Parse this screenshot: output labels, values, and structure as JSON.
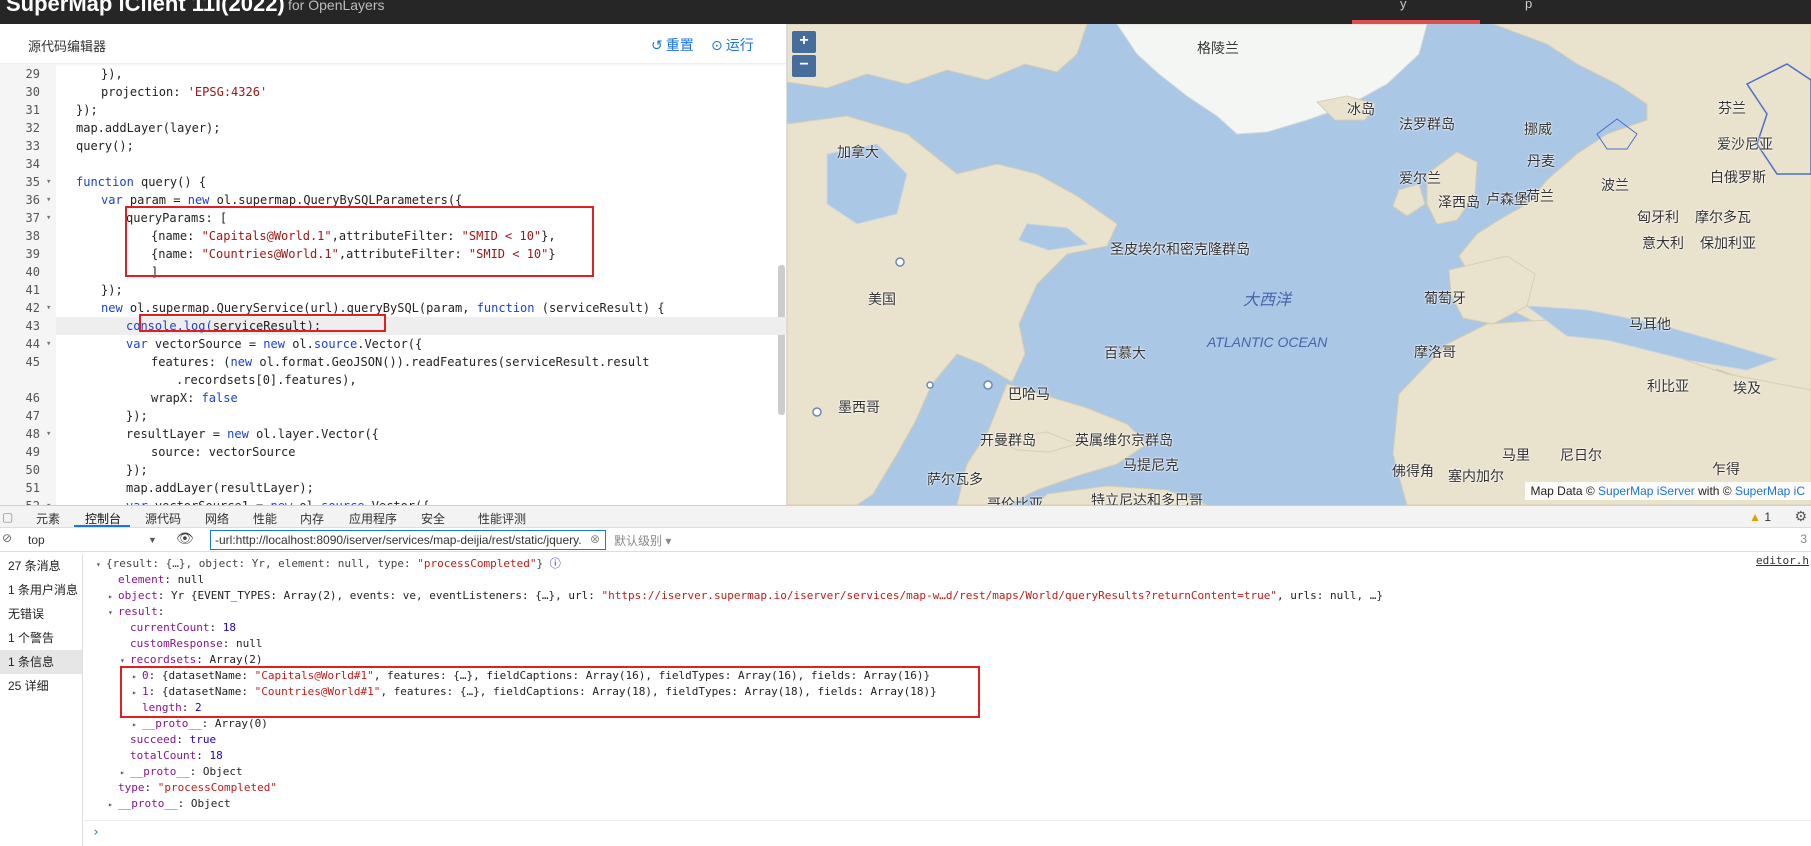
{
  "app": {
    "title": "SuperMap iClient 11i(2022)",
    "subtitle": "for OpenLayers",
    "tab_fragment_a": "y",
    "tab_fragment_b": "p"
  },
  "editor": {
    "title": "源代码编辑器",
    "reset_label": "重置",
    "run_label": "运行",
    "lines": [
      {
        "n": "29",
        "fold": "",
        "indent": 2,
        "segs": [
          {
            "t": "}),",
            "c": "plain"
          }
        ]
      },
      {
        "n": "30",
        "fold": "",
        "indent": 2,
        "segs": [
          {
            "t": "projection: ",
            "c": "plain"
          },
          {
            "t": "'EPSG:4326'",
            "c": "str"
          }
        ]
      },
      {
        "n": "31",
        "fold": "",
        "indent": 1,
        "segs": [
          {
            "t": "});",
            "c": "plain"
          }
        ]
      },
      {
        "n": "32",
        "fold": "",
        "indent": 1,
        "segs": [
          {
            "t": "map.addLayer(layer);",
            "c": "plain"
          }
        ]
      },
      {
        "n": "33",
        "fold": "",
        "indent": 1,
        "segs": [
          {
            "t": "query();",
            "c": "plain"
          }
        ]
      },
      {
        "n": "34",
        "fold": "",
        "indent": 0,
        "segs": []
      },
      {
        "n": "35",
        "fold": "▾",
        "indent": 1,
        "segs": [
          {
            "t": "function",
            "c": "kw"
          },
          {
            "t": " query() {",
            "c": "plain"
          }
        ]
      },
      {
        "n": "36",
        "fold": "▾",
        "indent": 2,
        "segs": [
          {
            "t": "var",
            "c": "kw"
          },
          {
            "t": " param = ",
            "c": "plain"
          },
          {
            "t": "new",
            "c": "kw"
          },
          {
            "t": " ol.supermap.QueryBySQLParameters({",
            "c": "plain"
          }
        ]
      },
      {
        "n": "37",
        "fold": "▾",
        "indent": 3,
        "segs": [
          {
            "t": "queryParams: [",
            "c": "plain"
          }
        ]
      },
      {
        "n": "38",
        "fold": "",
        "indent": 4,
        "segs": [
          {
            "t": "{name: ",
            "c": "plain"
          },
          {
            "t": "\"Capitals@World.1\"",
            "c": "str"
          },
          {
            "t": ",attributeFilter: ",
            "c": "plain"
          },
          {
            "t": "\"SMID < 10\"",
            "c": "str"
          },
          {
            "t": "},",
            "c": "plain"
          }
        ]
      },
      {
        "n": "39",
        "fold": "",
        "indent": 4,
        "segs": [
          {
            "t": "{name: ",
            "c": "plain"
          },
          {
            "t": "\"Countries@World.1\"",
            "c": "str"
          },
          {
            "t": ",attributeFilter: ",
            "c": "plain"
          },
          {
            "t": "\"SMID < 10\"",
            "c": "str"
          },
          {
            "t": "}",
            "c": "plain"
          }
        ]
      },
      {
        "n": "40",
        "fold": "",
        "indent": 4,
        "segs": [
          {
            "t": "]",
            "c": "plain"
          }
        ]
      },
      {
        "n": "41",
        "fold": "",
        "indent": 2,
        "segs": [
          {
            "t": "});",
            "c": "plain"
          }
        ]
      },
      {
        "n": "42",
        "fold": "▾",
        "indent": 2,
        "segs": [
          {
            "t": "new",
            "c": "kw"
          },
          {
            "t": " ol.supermap.QueryService(url).queryBySQL(param, ",
            "c": "plain"
          },
          {
            "t": "function",
            "c": "kw"
          },
          {
            "t": " (serviceResult) {",
            "c": "plain"
          }
        ]
      },
      {
        "n": "43",
        "fold": "",
        "indent": 3,
        "hl": true,
        "segs": [
          {
            "t": "console.log(",
            "c": "cl"
          },
          {
            "t": "serviceResult);",
            "c": "plain"
          }
        ]
      },
      {
        "n": "44",
        "fold": "▾",
        "indent": 3,
        "segs": [
          {
            "t": "var",
            "c": "kw"
          },
          {
            "t": " vectorSource = ",
            "c": "plain"
          },
          {
            "t": "new",
            "c": "kw"
          },
          {
            "t": " ol.",
            "c": "plain"
          },
          {
            "t": "source",
            "c": "kw"
          },
          {
            "t": ".Vector({",
            "c": "plain"
          }
        ]
      },
      {
        "n": "45",
        "fold": "",
        "indent": 4,
        "segs": [
          {
            "t": "features: (",
            "c": "plain"
          },
          {
            "t": "new",
            "c": "kw"
          },
          {
            "t": " ol.format.GeoJSON()).readFeatures(serviceResult.result",
            "c": "plain"
          }
        ]
      },
      {
        "n": "",
        "fold": "",
        "indent": 5,
        "segs": [
          {
            "t": ".recordsets[0].features),",
            "c": "plain"
          }
        ]
      },
      {
        "n": "46",
        "fold": "",
        "indent": 4,
        "segs": [
          {
            "t": "wrapX: ",
            "c": "plain"
          },
          {
            "t": "false",
            "c": "kw"
          }
        ]
      },
      {
        "n": "47",
        "fold": "",
        "indent": 3,
        "segs": [
          {
            "t": "});",
            "c": "plain"
          }
        ]
      },
      {
        "n": "48",
        "fold": "▾",
        "indent": 3,
        "segs": [
          {
            "t": "resultLayer = ",
            "c": "plain"
          },
          {
            "t": "new",
            "c": "kw"
          },
          {
            "t": " ol.layer.Vector({",
            "c": "plain"
          }
        ]
      },
      {
        "n": "49",
        "fold": "",
        "indent": 4,
        "segs": [
          {
            "t": "source: vectorSource",
            "c": "plain"
          }
        ]
      },
      {
        "n": "50",
        "fold": "",
        "indent": 3,
        "segs": [
          {
            "t": "});",
            "c": "plain"
          }
        ]
      },
      {
        "n": "51",
        "fold": "",
        "indent": 3,
        "segs": [
          {
            "t": "map.addLayer(resultLayer);",
            "c": "plain"
          }
        ]
      },
      {
        "n": "52",
        "fold": "▾",
        "indent": 3,
        "segs": [
          {
            "t": "var",
            "c": "kw"
          },
          {
            "t": " vectorSource1 = ",
            "c": "plain"
          },
          {
            "t": "new",
            "c": "kw"
          },
          {
            "t": " ol.",
            "c": "plain"
          },
          {
            "t": "source",
            "c": "kw"
          },
          {
            "t": ".Vector({",
            "c": "plain"
          }
        ]
      }
    ]
  },
  "map": {
    "zoom_in": "+",
    "zoom_out": "−",
    "labels": [
      {
        "name": "greenland",
        "text": "格陵兰"
      },
      {
        "name": "iceland",
        "text": "冰岛"
      },
      {
        "name": "canada",
        "text": "加拿大"
      },
      {
        "name": "faroe",
        "text": "法罗群岛"
      },
      {
        "name": "norway",
        "text": "挪威"
      },
      {
        "name": "denmark",
        "text": "丹麦"
      },
      {
        "name": "finland",
        "text": "芬兰"
      },
      {
        "name": "estonia",
        "text": "爱沙尼亚"
      },
      {
        "name": "ireland",
        "text": "爱尔兰"
      },
      {
        "name": "netherlands",
        "text": "荷兰"
      },
      {
        "name": "belarus",
        "text": "白俄罗斯"
      },
      {
        "name": "poland",
        "text": "波兰"
      },
      {
        "name": "uk-area",
        "text": "泽西岛"
      },
      {
        "name": "luxembourg",
        "text": "卢森堡"
      },
      {
        "name": "czech",
        "text": "匈牙利"
      },
      {
        "name": "moldova",
        "text": "摩尔多瓦"
      },
      {
        "name": "spm",
        "text": "圣皮埃尔和密克隆群岛"
      },
      {
        "name": "italy",
        "text": "意大利"
      },
      {
        "name": "bulgaria",
        "text": "保加利亚"
      },
      {
        "name": "usa",
        "text": "美国"
      },
      {
        "name": "portugal",
        "text": "葡萄牙"
      },
      {
        "name": "malta",
        "text": "马耳他"
      },
      {
        "name": "bermuda",
        "text": "百慕大"
      },
      {
        "name": "morocco",
        "text": "摩洛哥"
      },
      {
        "name": "libya",
        "text": "利比亚"
      },
      {
        "name": "egypt",
        "text": "埃及"
      },
      {
        "name": "bahamas",
        "text": "巴哈马"
      },
      {
        "name": "mexico",
        "text": "墨西哥"
      },
      {
        "name": "cayman",
        "text": "开曼群岛"
      },
      {
        "name": "bvi",
        "text": "英属维尔京群岛"
      },
      {
        "name": "mali",
        "text": "马里"
      },
      {
        "name": "niger",
        "text": "尼日尔"
      },
      {
        "name": "martinique",
        "text": "马提尼克"
      },
      {
        "name": "el-salvador",
        "text": "萨尔瓦多"
      },
      {
        "name": "cape-verde",
        "text": "佛得角"
      },
      {
        "name": "guinea",
        "text": "塞内加尔"
      },
      {
        "name": "chad",
        "text": "乍得"
      },
      {
        "name": "trinidad",
        "text": "特立尼达和多巴哥"
      },
      {
        "name": "colombia",
        "text": "哥伦比亚"
      }
    ],
    "ocean_cn": "大西洋",
    "ocean_en": "ATLANTIC OCEAN",
    "attribution_prefix": "Map Data ©",
    "attribution_link1": "SuperMap iServer",
    "attribution_mid": "with ©",
    "attribution_link2": "SuperMap iC"
  },
  "devtools": {
    "tabs": [
      "元素",
      "控制台",
      "源代码",
      "网络",
      "性能",
      "内存",
      "应用程序",
      "安全",
      "性能评测"
    ],
    "warning_count": "1",
    "context": "top",
    "filter_value": "-url:http://localhost:8090/iserver/services/map-deijia/rest/static/jquery.",
    "levels": "默认级别",
    "hidden_count": "3",
    "sidebar": [
      {
        "label": "27 条消息",
        "selected": false
      },
      {
        "label": "1 条用户消息",
        "selected": false
      },
      {
        "label": "无错误",
        "selected": false
      },
      {
        "label": "1 个警告",
        "selected": false
      },
      {
        "label": "1 条信息",
        "selected": true
      },
      {
        "label": "25 详细",
        "selected": false
      }
    ],
    "source_link": "editor.h",
    "console_lines": [
      {
        "indent": 1,
        "tri": "▾",
        "segs": [
          {
            "t": "{result: {…}, object: Yr, element: null, type: ",
            "c": "g"
          },
          {
            "t": "\"processCompleted\"",
            "c": "s"
          },
          {
            "t": "}",
            "c": "g"
          },
          {
            "t": " ⓘ",
            "c": "n"
          }
        ]
      },
      {
        "indent": 2,
        "tri": "",
        "segs": [
          {
            "t": "element",
            "c": "k"
          },
          {
            "t": ": null",
            "c": "b"
          }
        ]
      },
      {
        "indent": 2,
        "tri": "▸",
        "segs": [
          {
            "t": "object",
            "c": "k"
          },
          {
            "t": ": Yr {EVENT_TYPES: Array(2), events: ve, eventListeners: {…}, url: ",
            "c": "b"
          },
          {
            "t": "\"https://iserver.supermap.io/iserver/services/map-w…d/rest/maps/World/queryResults?returnContent=true\"",
            "c": "s"
          },
          {
            "t": ", urls: null, …}",
            "c": "b"
          }
        ]
      },
      {
        "indent": 2,
        "tri": "▾",
        "segs": [
          {
            "t": "result",
            "c": "k"
          },
          {
            "t": ":",
            "c": "b"
          }
        ]
      },
      {
        "indent": 3,
        "tri": "",
        "segs": [
          {
            "t": "currentCount",
            "c": "k"
          },
          {
            "t": ": ",
            "c": "b"
          },
          {
            "t": "18",
            "c": "n"
          }
        ]
      },
      {
        "indent": 3,
        "tri": "",
        "segs": [
          {
            "t": "customResponse",
            "c": "k"
          },
          {
            "t": ": null",
            "c": "b"
          }
        ]
      },
      {
        "indent": 3,
        "tri": "▾",
        "segs": [
          {
            "t": "recordsets",
            "c": "k"
          },
          {
            "t": ": Array(2)",
            "c": "b"
          }
        ]
      },
      {
        "indent": 4,
        "tri": "▸",
        "segs": [
          {
            "t": "0",
            "c": "k"
          },
          {
            "t": ": {datasetName: ",
            "c": "b"
          },
          {
            "t": "\"Capitals@World#1\"",
            "c": "s"
          },
          {
            "t": ", features: {…}, fieldCaptions: Array(16), fieldTypes: Array(16), fields: Array(16)}",
            "c": "b"
          }
        ]
      },
      {
        "indent": 4,
        "tri": "▸",
        "segs": [
          {
            "t": "1",
            "c": "k"
          },
          {
            "t": ": {datasetName: ",
            "c": "b"
          },
          {
            "t": "\"Countries@World#1\"",
            "c": "s"
          },
          {
            "t": ", features: {…}, fieldCaptions: Array(18), fieldTypes: Array(18), fields: Array(18)}",
            "c": "b"
          }
        ]
      },
      {
        "indent": 4,
        "tri": "",
        "segs": [
          {
            "t": "length",
            "c": "k"
          },
          {
            "t": ": ",
            "c": "b"
          },
          {
            "t": "2",
            "c": "n"
          }
        ]
      },
      {
        "indent": 4,
        "tri": "▸",
        "segs": [
          {
            "t": "__proto__",
            "c": "k"
          },
          {
            "t": ": Array(0)",
            "c": "b"
          }
        ]
      },
      {
        "indent": 3,
        "tri": "",
        "segs": [
          {
            "t": "succeed",
            "c": "k"
          },
          {
            "t": ": ",
            "c": "b"
          },
          {
            "t": "true",
            "c": "n"
          }
        ]
      },
      {
        "indent": 3,
        "tri": "",
        "segs": [
          {
            "t": "totalCount",
            "c": "k"
          },
          {
            "t": ": ",
            "c": "b"
          },
          {
            "t": "18",
            "c": "n"
          }
        ]
      },
      {
        "indent": 3,
        "tri": "▸",
        "segs": [
          {
            "t": "__proto__",
            "c": "k"
          },
          {
            "t": ": Object",
            "c": "b"
          }
        ]
      },
      {
        "indent": 2,
        "tri": "",
        "segs": [
          {
            "t": "type",
            "c": "k"
          },
          {
            "t": ": ",
            "c": "b"
          },
          {
            "t": "\"processCompleted\"",
            "c": "s"
          }
        ]
      },
      {
        "indent": 2,
        "tri": "▸",
        "segs": [
          {
            "t": "__proto__",
            "c": "k"
          },
          {
            "t": ": Object",
            "c": "b"
          }
        ]
      }
    ],
    "prompt": "›"
  }
}
